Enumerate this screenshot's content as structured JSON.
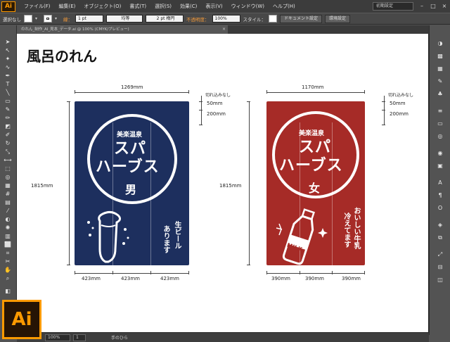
{
  "menubar": {
    "app_icon": "Ai",
    "items": [
      "ファイル(F)",
      "編集(E)",
      "オブジェクト(O)",
      "書式(T)",
      "選択(S)",
      "効果(C)",
      "表示(V)",
      "ウィンドウ(W)",
      "ヘルプ(H)"
    ],
    "workspace": "初期設定",
    "window_buttons": [
      "–",
      "□",
      "×"
    ]
  },
  "controlbar": {
    "selection": "選択なし",
    "stroke_label": "線：",
    "stroke_weight": "1 pt",
    "profile": "均等",
    "brush": "2 pt 楕円",
    "opacity_label": "不透明度：",
    "opacity": "100%",
    "style_label": "スタイル：",
    "doc_settings": "ドキュメント設定",
    "prefs": "環境設定"
  },
  "document_tab": {
    "title": "のれん_制作_AI_見本_データ.ai @ 100% (CMYK/プレビュー)",
    "close": "×"
  },
  "canvas": {
    "title": "風呂のれん",
    "men": {
      "width_label": "1269mm",
      "height_label": "1815mm",
      "cut_label": "切れ込みなし",
      "top_label": "50mm",
      "slit_label": "200mm",
      "panel_widths": [
        "423mm",
        "423mm",
        "423mm"
      ],
      "subtitle": "美楽温泉",
      "line1": "スパ",
      "line2": "ハーブス",
      "gender": "男",
      "side_text_1": "生ビール",
      "side_text_2": "あります",
      "color": "#1d2f5e"
    },
    "women": {
      "width_label": "1170mm",
      "height_label": "1815mm",
      "cut_label": "切れ込みなし",
      "top_label": "50mm",
      "slit_label": "200mm",
      "panel_widths": [
        "390mm",
        "390mm",
        "390mm"
      ],
      "subtitle": "美楽温泉",
      "line1": "スパ",
      "line2": "ハーブス",
      "gender": "女",
      "side_text_1": "おいしい牛乳",
      "side_text_2": "冷えてます",
      "milk_label": "MILK",
      "color": "#a62b27"
    }
  },
  "statusbar": {
    "zoom": "100%",
    "artboard": "1",
    "tool_name": "手のひら"
  },
  "ai_logo": "Ai",
  "icons": [
    "selection-tool-icon",
    "direct-selection-icon",
    "magic-wand-icon",
    "lasso-icon",
    "pen-icon",
    "type-icon",
    "line-icon",
    "rectangle-icon",
    "paintbrush-icon",
    "pencil-icon",
    "eraser-icon",
    "rotate-icon",
    "scale-icon",
    "width-icon",
    "free-transform-icon",
    "shape-builder-icon",
    "perspective-icon",
    "mesh-icon",
    "gradient-icon",
    "eyedropper-icon",
    "blend-icon",
    "symbol-sprayer-icon",
    "graph-icon",
    "artboard-icon",
    "slice-icon",
    "hand-icon",
    "zoom-icon"
  ]
}
